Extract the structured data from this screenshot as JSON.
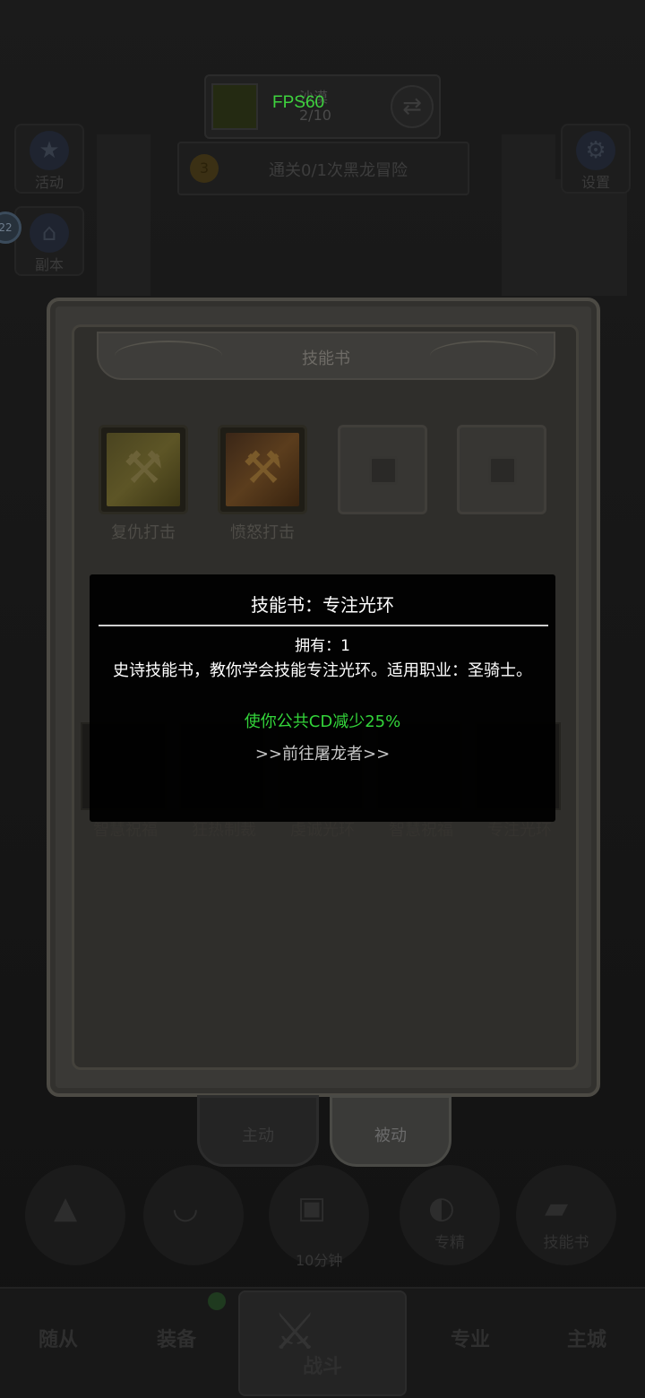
{
  "hud": {
    "fps": "FPS60",
    "location_faded": "沙漠",
    "location_level_faded": "2/10",
    "quest_text": "通关0/1次黑龙冒险",
    "quest_coin": "3",
    "notification_count": "22",
    "side_activity": "活动",
    "side_dungeon": "副本",
    "side_settings": "设置"
  },
  "panel": {
    "title": "技能书",
    "owned_skills": [
      {
        "name": "复仇打击",
        "icon": "hammer-glow-icon"
      },
      {
        "name": "愤怒打击",
        "icon": "hammer-fire-icon"
      }
    ],
    "locked_slots": 2,
    "book_row": [
      "智慧祝福",
      "狂热制裁",
      "虔诚光环",
      "智慧祝福",
      "专注光环"
    ],
    "tabs": {
      "active": "主动",
      "passive": "被动"
    }
  },
  "tooltip": {
    "title": "技能书：专注光环",
    "owned": "拥有：1",
    "description": "史诗技能书，教你学会技能专注光环。适用职业：圣骑士。",
    "effect": "使你公共CD减少25%",
    "link": ">>前往屠龙者>>",
    "effect_color": "#33d43a"
  },
  "shortcuts": {
    "timer": "10分钟",
    "specialty": "专精",
    "skillbook": "技能书"
  },
  "nav": {
    "followers": "随从",
    "equipment": "装备",
    "battle": "战斗",
    "profession": "专业",
    "city": "主城"
  }
}
